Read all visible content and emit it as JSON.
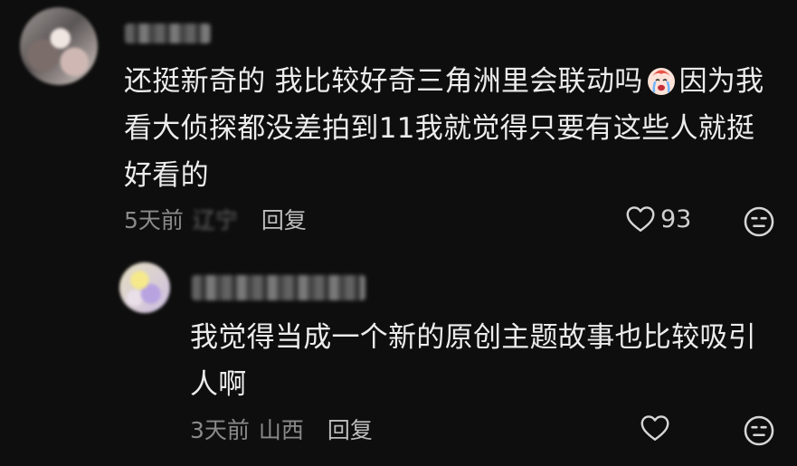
{
  "comments": [
    {
      "username": "",
      "text_line1": "还挺新奇的 我比较好奇三角洲里会联动吗",
      "emoji": "crying-face-emoji",
      "text_line1b": "因为我",
      "text_line2": "看大侦探都没差拍到11我就觉得只要有这些人就挺",
      "text_line3": "好看的",
      "time": "5天前",
      "location": "辽宁",
      "reply_label": "回复",
      "like_count": "93"
    },
    {
      "username": "",
      "text_line1": "我觉得当成一个新的原创主题故事也比较吸引",
      "text_line2": "人啊",
      "time": "3天前",
      "location": "山西",
      "reply_label": "回复",
      "like_count": ""
    }
  ],
  "icons": {
    "like": "heart-outline-icon",
    "reaction": "neutral-face-icon"
  },
  "colors": {
    "background": "#0e0e0e",
    "text": "#ececec",
    "meta": "#8a8a8a"
  }
}
